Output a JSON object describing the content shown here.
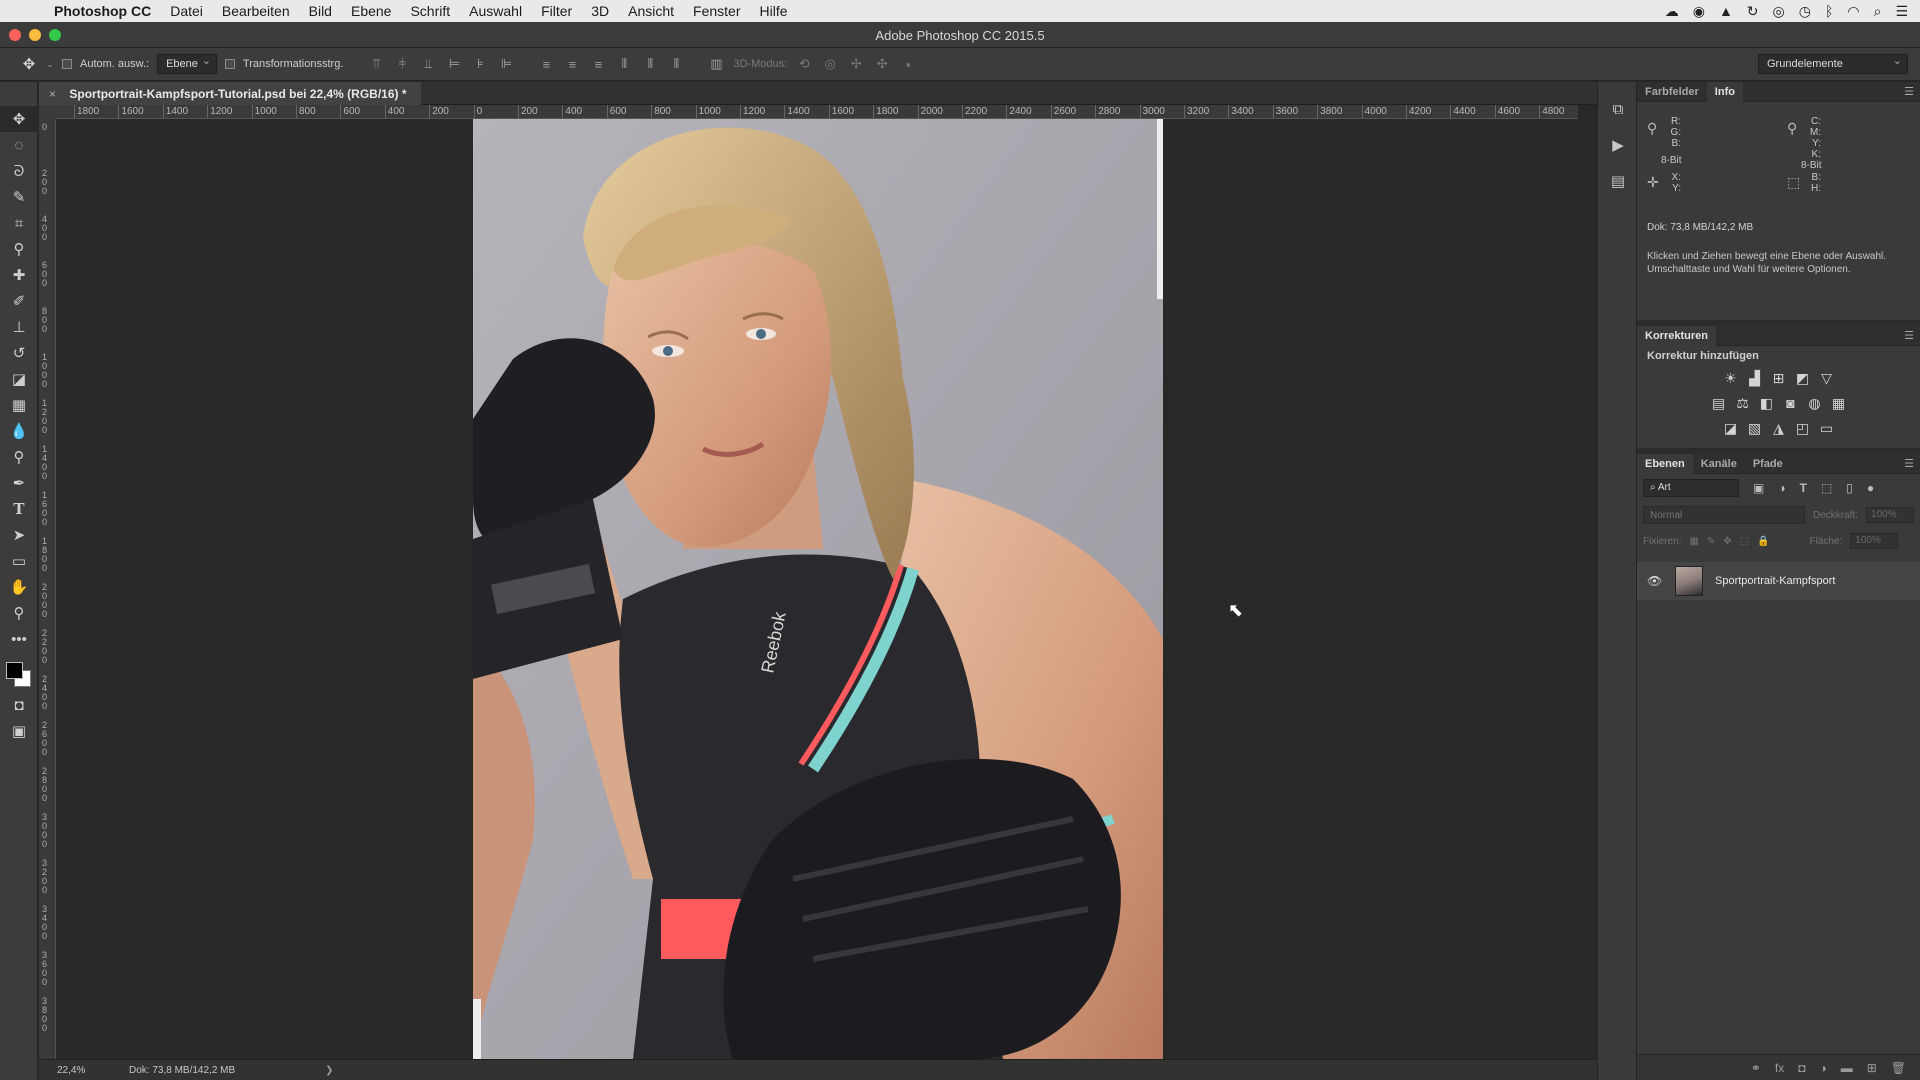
{
  "menubar": {
    "app_name": "Photoshop CC",
    "items": [
      "Datei",
      "Bearbeiten",
      "Bild",
      "Ebene",
      "Schrift",
      "Auswahl",
      "Filter",
      "3D",
      "Ansicht",
      "Fenster",
      "Hilfe"
    ]
  },
  "window": {
    "title": "Adobe Photoshop CC 2015.5"
  },
  "options": {
    "auto_select_label": "Autom. ausw.:",
    "auto_select_value": "Ebene",
    "transform_label": "Transformationsstrg.",
    "mode_3d_label": "3D-Modus:",
    "workspace": "Grundelemente"
  },
  "document": {
    "tab_title": "Sportportrait-Kampfsport-Tutorial.psd bei 22,4% (RGB/16) *",
    "close_glyph": "×"
  },
  "ruler": {
    "labels": [
      "1800",
      "1600",
      "1400",
      "1200",
      "1000",
      "800",
      "600",
      "400",
      "200",
      "0",
      "200",
      "400",
      "600",
      "800",
      "1000",
      "1200",
      "1400",
      "1600",
      "1800",
      "2000",
      "2200",
      "2400",
      "2600",
      "2800",
      "3000",
      "3200",
      "3400",
      "3600",
      "3800",
      "4000",
      "4200",
      "4400",
      "4600",
      "4800"
    ],
    "vertical_labels": [
      "0",
      "200",
      "400",
      "600",
      "800",
      "1000",
      "1200",
      "1400",
      "1600",
      "1800",
      "2000",
      "2200",
      "2400",
      "2600",
      "2800",
      "3000",
      "3200",
      "3400",
      "3600",
      "3800"
    ]
  },
  "status": {
    "zoom": "22,4%",
    "doc": "Dok: 73,8 MB/142,2 MB",
    "arrow": "❯"
  },
  "info_panel": {
    "tabs": [
      "Farbfelder",
      "Info"
    ],
    "active_tab": "Info",
    "rgb_labels": [
      "R:",
      "G:",
      "B:"
    ],
    "cmyk_labels": [
      "C:",
      "M:",
      "Y:",
      "K:"
    ],
    "bitdepth_left": "8-Bit",
    "bitdepth_right": "8-Bit",
    "xy_labels": [
      "X:",
      "Y:"
    ],
    "bh_labels": [
      "B:",
      "H:"
    ],
    "doc": "Dok: 73,8 MB/142,2 MB",
    "hint": "Klicken und Ziehen bewegt eine Ebene oder Auswahl. Umschalttaste und Wahl für weitere Optionen."
  },
  "korrekturen": {
    "title": "Korrekturen",
    "subtitle": "Korrektur hinzufügen"
  },
  "layers_panel": {
    "tabs": [
      "Ebenen",
      "Kanäle",
      "Pfade"
    ],
    "active_tab": "Ebenen",
    "filter_label": "Art",
    "blend_mode": "Normal",
    "opacity_label": "Deckkraft:",
    "opacity_value": "100%",
    "lock_label": "Fixieren:",
    "fill_label": "Fläche:",
    "fill_value": "100%",
    "layers": [
      {
        "name": "Sportportrait-Kampfsport",
        "visible": true
      }
    ]
  },
  "photo": {
    "brand_text": "Reebok"
  },
  "colors": {
    "accent_close": "#fc605b",
    "accent_min": "#fdbc40",
    "accent_max": "#34c84a",
    "bra_trim": "#ff5b5e",
    "bra_strap": "#7fd3cf"
  }
}
